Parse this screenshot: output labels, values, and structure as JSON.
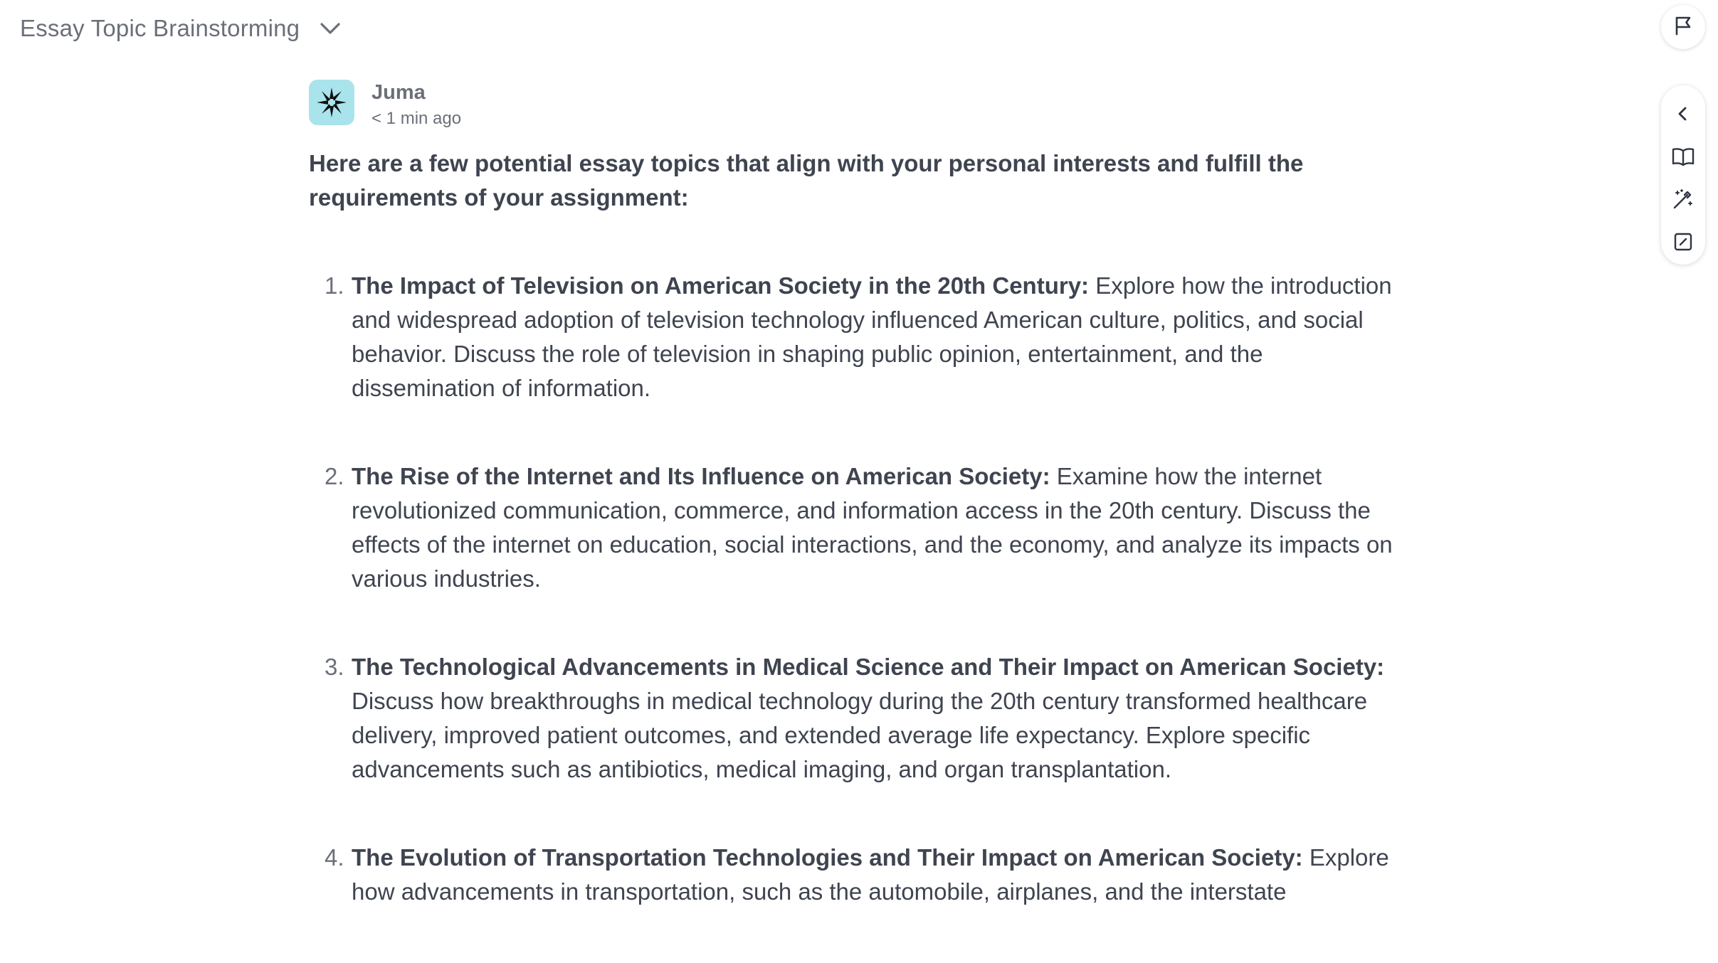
{
  "header": {
    "title": "Essay Topic Brainstorming"
  },
  "icons": {
    "title_dropdown": "chevron-down-icon",
    "flag": "flag-icon",
    "collapse": "chevron-left-icon",
    "book": "book-open-icon",
    "magic": "magic-wand-icon",
    "edit": "edit-square-icon"
  },
  "colors": {
    "avatar_bg": "#a9e4ec",
    "text": "#3f4450",
    "muted": "#6b6f78"
  },
  "message": {
    "author": "Juma",
    "time": "< 1 min ago",
    "intro": "Here are a few potential essay topics that align with your personal interests and fulfill the requirements of your assignment:",
    "items": [
      {
        "number": "1.",
        "title": "The Impact of Television on American Society in the 20th Century:",
        "body": "Explore how the introduction and widespread adoption of television technology influenced American culture, politics, and social behavior. Discuss the role of television in shaping public opinion, entertainment, and the dissemination of information."
      },
      {
        "number": "2.",
        "title": "The Rise of the Internet and Its Influence on American Society:",
        "body": "Examine how the internet revolutionized communication, commerce, and information access in the 20th century. Discuss the effects of the internet on education, social interactions, and the economy, and analyze its impacts on various industries."
      },
      {
        "number": "3.",
        "title": "The Technological Advancements in Medical Science and Their Impact on American Society:",
        "body": "Discuss how breakthroughs in medical technology during the 20th century transformed healthcare delivery, improved patient outcomes, and extended average life expectancy. Explore specific advancements such as antibiotics, medical imaging, and organ transplantation."
      },
      {
        "number": "4.",
        "title": "The Evolution of Transportation Technologies and Their Impact on American Society:",
        "body": "Explore how advancements in transportation, such as the automobile, airplanes, and the interstate"
      }
    ]
  }
}
